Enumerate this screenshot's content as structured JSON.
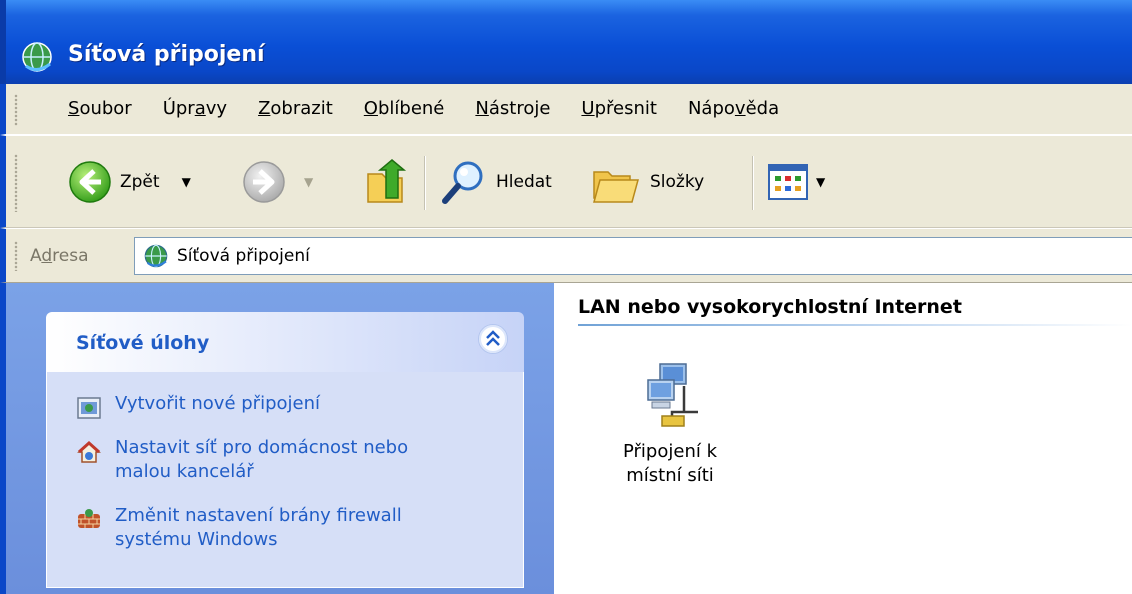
{
  "window": {
    "title": "Síťová připojení"
  },
  "menu": {
    "items": [
      {
        "label": "Soubor",
        "access": "S"
      },
      {
        "label": "Úpravy",
        "access": "a"
      },
      {
        "label": "Zobrazit",
        "access": "Z"
      },
      {
        "label": "Oblíbené",
        "access": "O"
      },
      {
        "label": "Nástroje",
        "access": "N"
      },
      {
        "label": "Upřesnit",
        "access": "U"
      },
      {
        "label": "Nápověda",
        "access": "v"
      }
    ]
  },
  "toolbar": {
    "back_label": "Zpět",
    "search_label": "Hledat",
    "folders_label": "Složky",
    "icons": {
      "back": "back-arrow-icon",
      "forward": "forward-arrow-icon",
      "up": "folder-up-icon",
      "search": "search-icon",
      "folders": "folders-icon",
      "views": "views-icon"
    }
  },
  "address": {
    "label": "Adresa",
    "value": "Síťová připojení"
  },
  "taskpane": {
    "title": "Síťové úlohy",
    "tasks": [
      {
        "label": "Vytvořit nové připojení",
        "icon": "new-connection-icon"
      },
      {
        "label": "Nastavit síť pro domácnost nebo malou kancelář",
        "icon": "home-network-icon"
      },
      {
        "label": "Změnit nastavení brány firewall systému Windows",
        "icon": "firewall-icon"
      }
    ]
  },
  "main": {
    "section_title": "LAN nebo vysokorychlostní Internet",
    "items": [
      {
        "label": "Připojení k místní síti",
        "icon": "lan-connection-icon"
      }
    ]
  },
  "colors": {
    "titlebar": "#0a4fd6",
    "chrome": "#ece9d8",
    "taskpane_bg": "#7ba2e7",
    "task_link": "#215dc6"
  }
}
